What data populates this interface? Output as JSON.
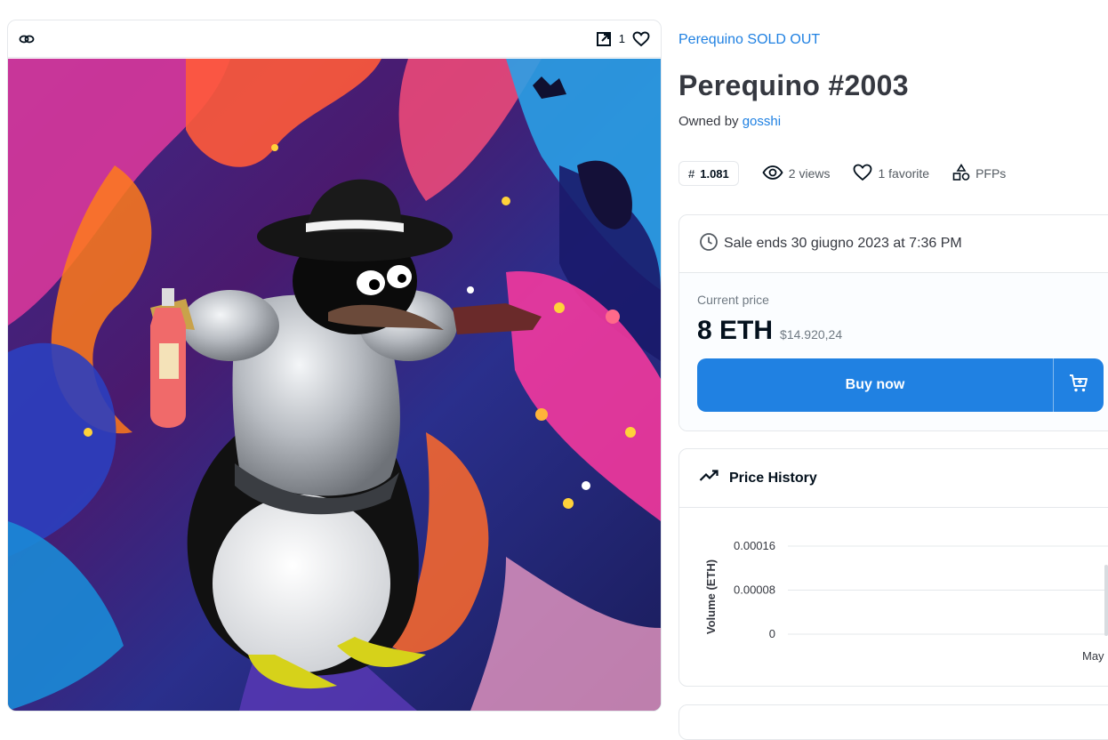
{
  "media": {
    "chain_icon": "link-icon",
    "external_icon": "open-external-icon",
    "favorite_count": "1",
    "heart_icon": "heart-icon"
  },
  "item": {
    "collection_name": "Perequino SOLD OUT",
    "title": "Perequino #2003",
    "owned_by_label": "Owned by",
    "owner": "gosshi"
  },
  "stats": {
    "rank_prefix": "#",
    "rank": "1.081",
    "views": "2 views",
    "favorites": "1 favorite",
    "category": "PFPs"
  },
  "sale": {
    "ends_text": "Sale ends 30 giugno 2023 at 7:36 PM",
    "current_price_label": "Current price",
    "price_eth": "8 ETH",
    "price_usd": "$14.920,24",
    "buy_label": "Buy now",
    "accent_color": "#2081e2"
  },
  "price_history": {
    "title": "Price History"
  },
  "chart_data": {
    "type": "line",
    "ylabel": "Volume (ETH)",
    "yticks": [
      "0.00016",
      "0.00008",
      "0"
    ],
    "ylim": [
      0,
      0.00016
    ],
    "x_tick_labels": [
      "May"
    ],
    "series": [],
    "grid": true
  }
}
